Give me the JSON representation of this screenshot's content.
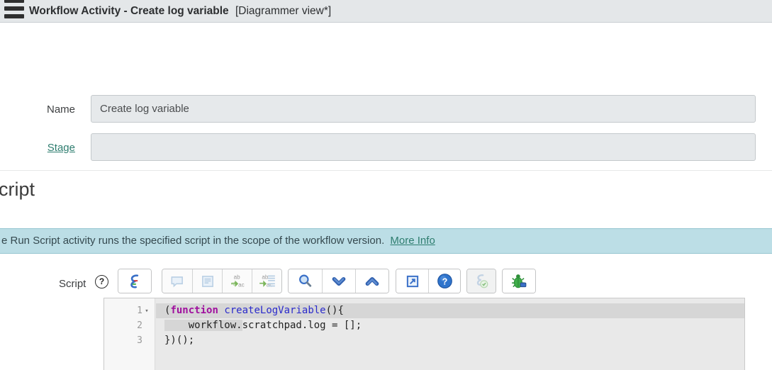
{
  "header": {
    "title_main": "Workflow Activity - Create log variable",
    "title_view": "[Diagrammer view*]",
    "menu_icon": "hamburger-menu-icon"
  },
  "form": {
    "name": {
      "label": "Name",
      "value": "Create log variable"
    },
    "stage": {
      "label": "Stage",
      "value": ""
    }
  },
  "section_heading": "cript",
  "info_banner": {
    "text": "e Run Script activity runs the specified script in the scope of the workflow version.",
    "link_label": "More Info"
  },
  "script_section": {
    "label": "Script",
    "help_icon": "question-circle-outline-icon",
    "toolbar_buttons": [
      {
        "name": "syntax-editor-toggle-button",
        "icon": "script-syntax-icon",
        "enabled": true
      },
      {
        "name": "comment-toggle-button",
        "icon": "speech-bubble-icon",
        "enabled": false
      },
      {
        "name": "format-code-button",
        "icon": "format-lines-icon",
        "enabled": false
      },
      {
        "name": "replace-button",
        "icon": "replace-ab-ac-icon",
        "enabled": false
      },
      {
        "name": "replace-all-button",
        "icon": "replace-all-icon",
        "enabled": false
      },
      {
        "name": "search-button",
        "icon": "magnifier-icon",
        "enabled": true
      },
      {
        "name": "find-next-button",
        "icon": "chevron-down-icon",
        "enabled": true
      },
      {
        "name": "find-previous-button",
        "icon": "chevron-up-icon",
        "enabled": true
      },
      {
        "name": "open-in-window-button",
        "icon": "pop-out-icon",
        "enabled": true
      },
      {
        "name": "editor-help-button",
        "icon": "question-circle-filled-icon",
        "enabled": true
      },
      {
        "name": "script-check-button",
        "icon": "script-check-icon",
        "enabled": false
      },
      {
        "name": "script-debugger-button",
        "icon": "debug-bug-icon",
        "enabled": true
      }
    ]
  },
  "editor": {
    "lines": [
      {
        "number": "1",
        "has_fold_marker": true,
        "selection": "full",
        "tokens": [
          {
            "text": "(",
            "type": "plain"
          },
          {
            "text": "function",
            "type": "keyword"
          },
          {
            "text": " ",
            "type": "plain"
          },
          {
            "text": "createLogVariable",
            "type": "fname"
          },
          {
            "text": "(){",
            "type": "plain"
          }
        ]
      },
      {
        "number": "2",
        "has_fold_marker": false,
        "selection": "partial",
        "tokens": [
          {
            "text": "    workflow.",
            "type": "plain",
            "selected": true
          },
          {
            "text": "scratchpad.log = [];",
            "type": "plain"
          }
        ]
      },
      {
        "number": "3",
        "has_fold_marker": false,
        "selection": "none",
        "tokens": [
          {
            "text": "})();",
            "type": "plain"
          }
        ]
      }
    ]
  },
  "colors": {
    "header_bg": "#e4e7e9",
    "banner_bg": "#bcdee6",
    "accent_teal": "#2e7d6f",
    "input_bg": "#e6e9eb",
    "icon_blue": "#3a70c8",
    "keyword": "#a0109e",
    "function_name": "#2a2acb",
    "editor_bg": "#e9e9e9",
    "selection_bg": "#d6d6d6"
  }
}
